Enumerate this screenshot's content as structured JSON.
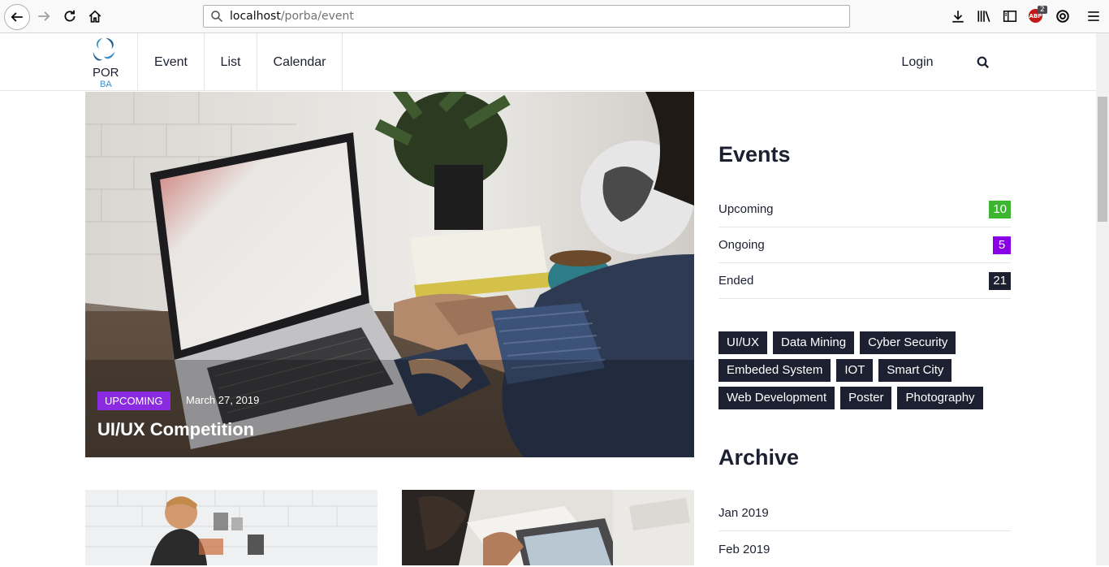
{
  "browser": {
    "url_host": "localhost",
    "url_path": "/porba/event",
    "abp_count": "2",
    "abp_label": "ABP"
  },
  "site": {
    "logo_top": "POR",
    "logo_bottom": "BA",
    "nav": [
      "Event",
      "List",
      "Calendar"
    ],
    "login": "Login"
  },
  "hero": {
    "status": "UPCOMING",
    "date": "March 27, 2019",
    "title": "UI/UX Competition",
    "status_color": "#8a00e6"
  },
  "sidebar": {
    "events_title": "Events",
    "events": [
      {
        "label": "Upcoming",
        "count": "10",
        "color": "#3cb531"
      },
      {
        "label": "Ongoing",
        "count": "5",
        "color": "#8a00e6"
      },
      {
        "label": "Ended",
        "count": "21",
        "color": "#1d2030"
      }
    ],
    "tags": [
      "UI/UX",
      "Data Mining",
      "Cyber Security",
      "Embeded System",
      "IOT",
      "Smart City",
      "Web Development",
      "Poster",
      "Photography"
    ],
    "archive_title": "Archive",
    "archive": [
      "Jan 2019",
      "Feb 2019"
    ]
  }
}
